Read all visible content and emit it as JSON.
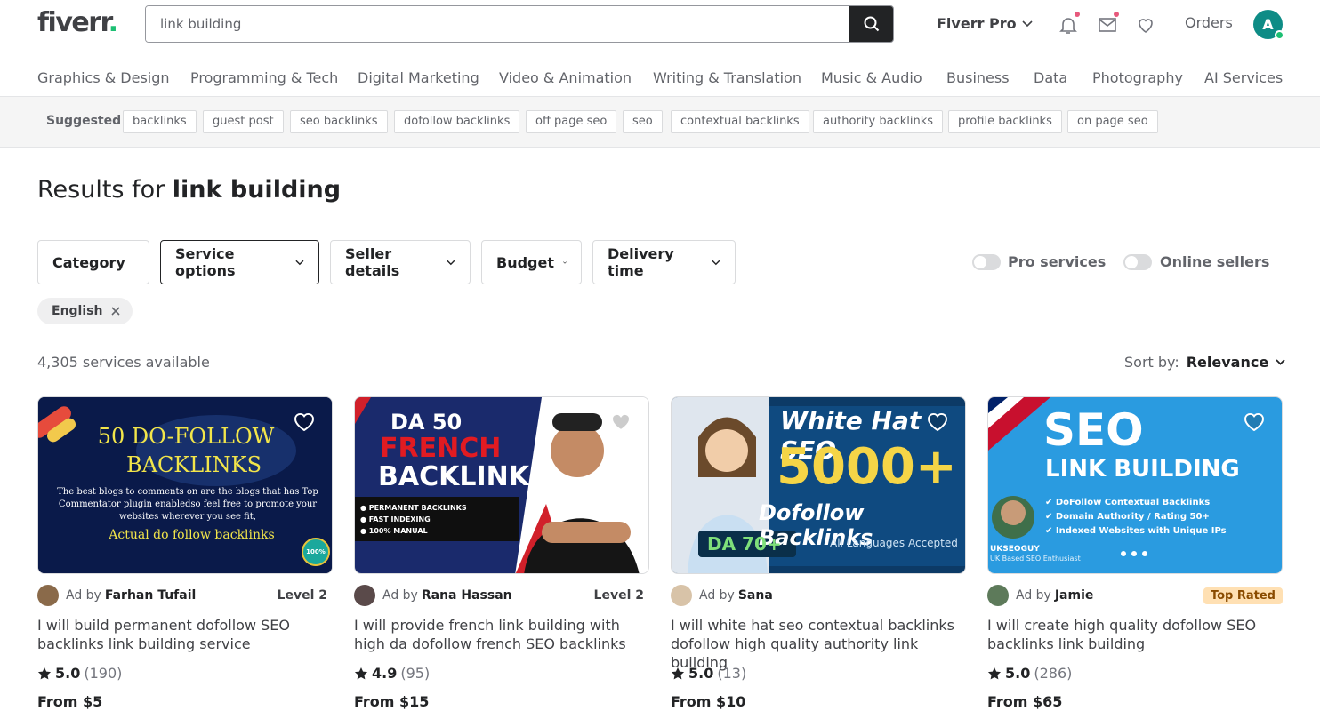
{
  "header": {
    "logo": "fiverr",
    "logo_dot": ".",
    "search_value": "link building",
    "fiverr_pro": "Fiverr Pro",
    "orders": "Orders",
    "avatar_letter": "A"
  },
  "categories": [
    "Graphics & Design",
    "Programming & Tech",
    "Digital Marketing",
    "Video & Animation",
    "Writing & Translation",
    "Music & Audio",
    "Business",
    "Data",
    "Photography",
    "AI Services"
  ],
  "suggested": {
    "label": "Suggested",
    "chips": [
      "backlinks",
      "guest post",
      "seo backlinks",
      "dofollow backlinks",
      "off page seo",
      "seo",
      "contextual backlinks",
      "authority backlinks",
      "profile backlinks",
      "on page seo"
    ]
  },
  "results": {
    "prefix": "Results for",
    "query": "link building"
  },
  "filters": [
    "Category",
    "Service options",
    "Seller details",
    "Budget",
    "Delivery time"
  ],
  "toggles": [
    "Pro services",
    "Online sellers"
  ],
  "active_tag": "English",
  "count_text": "4,305 services available",
  "sort": {
    "label": "Sort by:",
    "value": "Relevance"
  },
  "gigs": [
    {
      "ad_by": "Ad by",
      "seller": "Farhan Tufail",
      "badge": "Level 2",
      "title": "I will build permanent dofollow SEO backlinks link building service",
      "rating": "5.0",
      "reviews": "(190)",
      "price": "From $5",
      "thumb": {
        "line1": "50 DO-FOLLOW",
        "line2": "BACKLINKS",
        "small": "The best blogs to comments on are the blogs that has Top Commentator plugin enabledso feel free to promote your websites wherever you see fit,",
        "footer": "Actual do follow backlinks",
        "seal": "100%"
      }
    },
    {
      "ad_by": "Ad by",
      "seller": "Rana Hassan",
      "badge": "Level 2",
      "title": "I will provide french link building with high da dofollow french SEO backlinks",
      "rating": "4.9",
      "reviews": "(95)",
      "price": "From $15",
      "thumb": {
        "line1": "DA 50",
        "line2": "FRENCH",
        "line3": "BACKLINKS",
        "bullets": [
          "PERMANENT BACKLINKS",
          "FAST INDEXING",
          "100% MANUAL"
        ]
      }
    },
    {
      "ad_by": "Ad by",
      "seller": "Sana",
      "badge": "",
      "title": "I will white hat seo contextual backlinks dofollow high quality authority link building",
      "rating": "5.0",
      "reviews": "(13)",
      "price": "From $10",
      "thumb": {
        "line1": "White Hat SEO",
        "line2": "5000+",
        "line3": "Dofollow Backlinks",
        "da": "DA 70+",
        "lang": "All Languages Accepted"
      }
    },
    {
      "ad_by": "Ad by",
      "seller": "Jamie",
      "badge": "Top Rated",
      "title": "I will create high quality dofollow SEO backlinks link building",
      "rating": "5.0",
      "reviews": "(286)",
      "price": "From $65",
      "thumb": {
        "line1": "SEO",
        "line2": "LINK BUILDING",
        "bullets": [
          "DoFollow Contextual Backlinks",
          "Domain Authority / Rating 50+",
          "Indexed Websites with Unique IPs"
        ],
        "brand": "UKSEOGUY",
        "brand_sub": "UK Based SEO Enthusiast"
      }
    }
  ],
  "colors": {
    "brand_green": "#1dbf73",
    "dark": "#222325",
    "top_rated_bg": "#ffe0b3"
  }
}
